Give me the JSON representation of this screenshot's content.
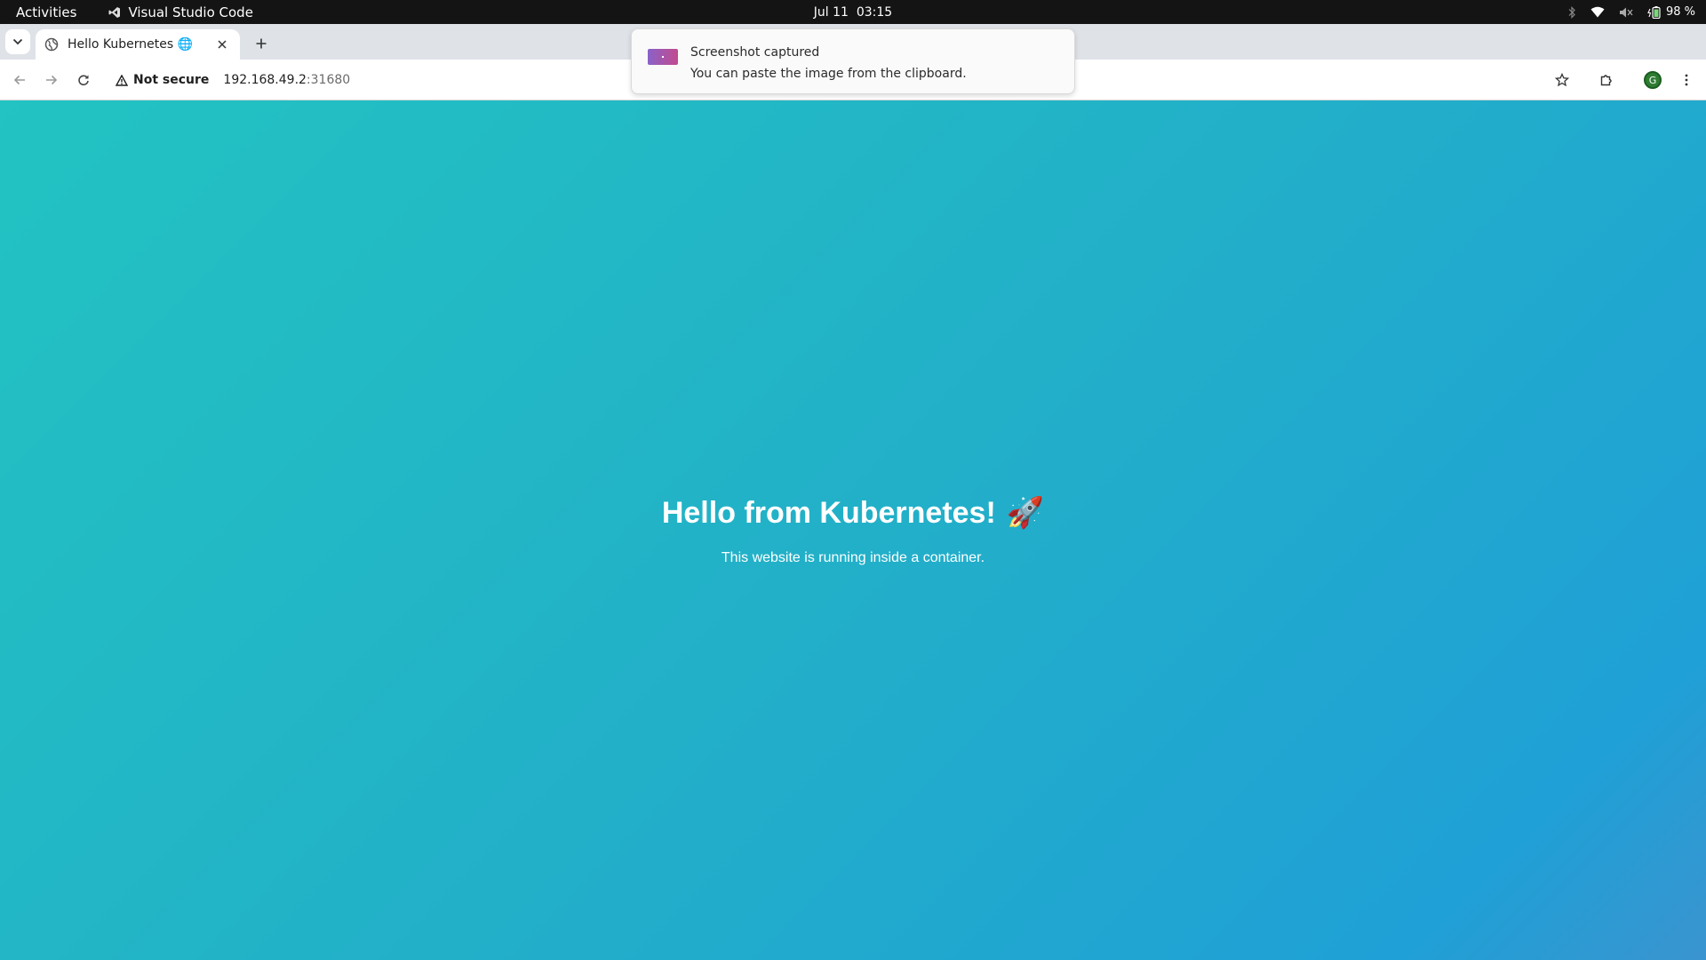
{
  "system": {
    "activities": "Activities",
    "app_name": "Visual Studio Code",
    "date": "Jul 11",
    "time": "03:15",
    "battery": "98 %"
  },
  "browser": {
    "tab": {
      "title": "Hello Kubernetes 🌐"
    },
    "security_label": "Not secure",
    "url_host": "192.168.49.2",
    "url_port": ":31680",
    "profile_initial": "G"
  },
  "notification": {
    "title": "Screenshot captured",
    "body": "You can paste the image from the clipboard."
  },
  "page": {
    "heading": "Hello from Kubernetes!",
    "heading_emoji": "🚀",
    "subtitle": "This website is running inside a container."
  }
}
